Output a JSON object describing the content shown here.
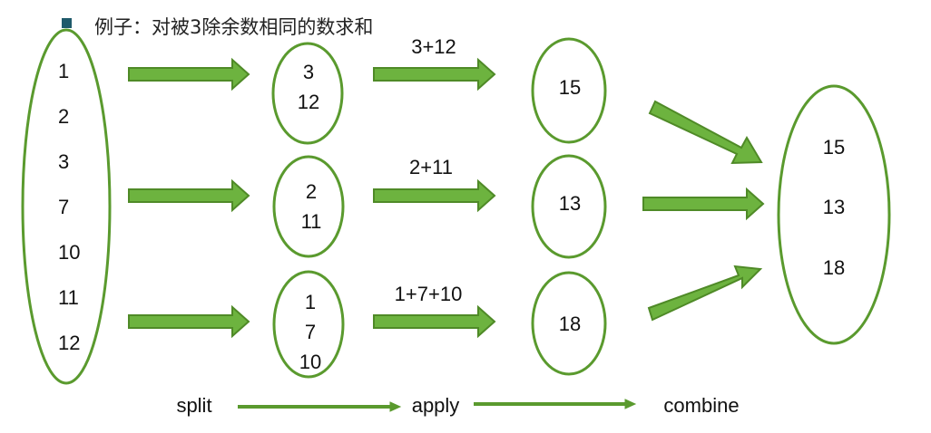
{
  "title": "例子：对被3除余数相同的数求和",
  "colors": {
    "outline": "#5a9a2e",
    "arrow_fill": "#6db33f",
    "arrow_stroke": "#4f8a27",
    "bullet": "#1f5a6b"
  },
  "input": [
    "1",
    "2",
    "3",
    "7",
    "10",
    "11",
    "12"
  ],
  "groups": [
    {
      "items": [
        "3",
        "12"
      ],
      "expr": "3+12",
      "sum": "15"
    },
    {
      "items": [
        "2",
        "11"
      ],
      "expr": "2+11",
      "sum": "13"
    },
    {
      "items": [
        "1",
        "7",
        "10"
      ],
      "expr": "1+7+10",
      "sum": "18"
    }
  ],
  "combined": [
    "15",
    "13",
    "18"
  ],
  "steps": {
    "split": "split",
    "apply": "apply",
    "combine": "combine"
  }
}
